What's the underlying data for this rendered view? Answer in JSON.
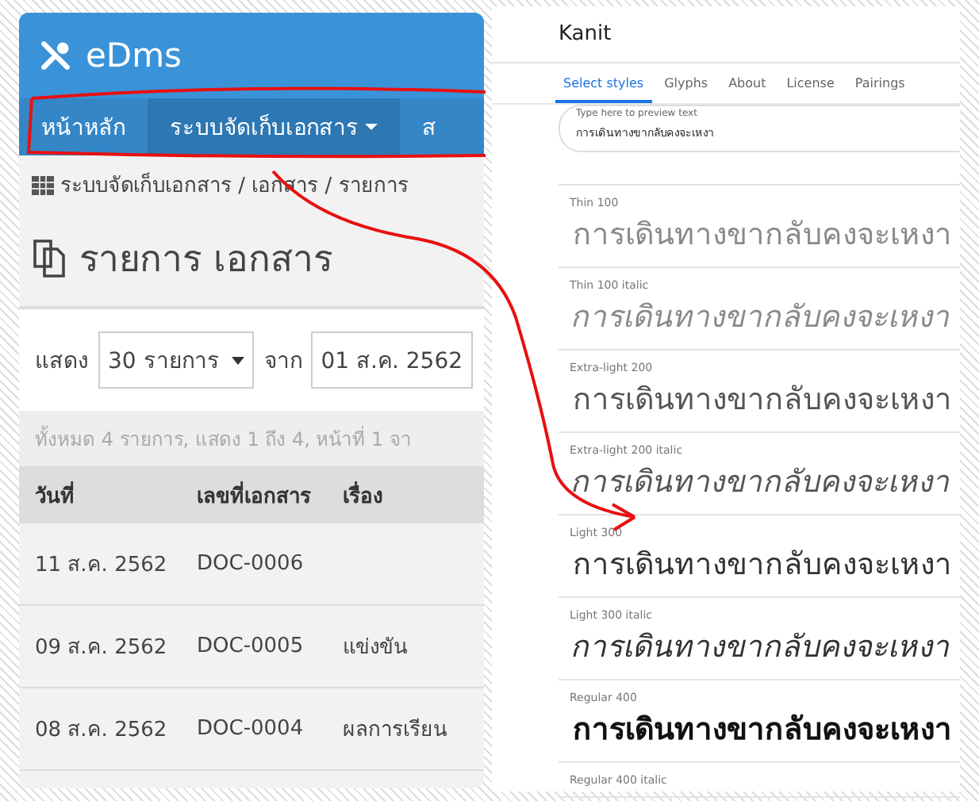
{
  "left_window": {
    "app_title": "eDms",
    "nav": [
      {
        "label": "หน้าหลัก",
        "selected": false,
        "dropdown": false
      },
      {
        "label": "ระบบจัดเก็บเอกสาร",
        "selected": true,
        "dropdown": true
      },
      {
        "label": "ส",
        "selected": false,
        "dropdown": false
      }
    ],
    "breadcrumb": "ระบบจัดเก็บเอกสาร / เอกสาร / รายการ",
    "page_title": "รายการ เอกสาร",
    "filter": {
      "show_label": "แสดง",
      "page_size": "30 รายการ",
      "from_label": "จาก",
      "from_date": "01 ส.ค. 2562"
    },
    "summary": "ทั้งหมด 4 รายการ, แสดง 1 ถึง 4, หน้าที่ 1 จา",
    "table": {
      "columns": [
        "วันที่",
        "เลขที่เอกสาร",
        "เรื่อง"
      ],
      "rows": [
        {
          "date": "11 ส.ค. 2562",
          "doc_no": "DOC-0006"
        },
        {
          "date": "09 ส.ค. 2562",
          "doc_no": "DOC-0005",
          "subject": "แข่งขัน"
        },
        {
          "date": "08 ส.ค. 2562",
          "doc_no": "DOC-0004",
          "subject": "ผลการเรียน"
        }
      ]
    }
  },
  "right_window": {
    "font_name": "Kanit",
    "tabs": [
      {
        "label": "Select styles",
        "selected": true
      },
      {
        "label": "Glyphs",
        "selected": false
      },
      {
        "label": "About",
        "selected": false
      },
      {
        "label": "License",
        "selected": false
      },
      {
        "label": "Pairings",
        "selected": false
      }
    ],
    "preview_field": {
      "label": "Type here to preview text",
      "value": "การเดินทางขากลับคงจะเหงา"
    },
    "styles": [
      {
        "label": "Thin 100",
        "kind": "thin",
        "italic": false,
        "sample": "การเดินทางขากลับคงจะเหงา"
      },
      {
        "label": "Thin 100 italic",
        "kind": "thin",
        "italic": true,
        "sample": "การเดินทางขากลับคงจะเหงา"
      },
      {
        "label": "Extra-light 200",
        "kind": "extralight",
        "italic": false,
        "sample": "การเดินทางขากลับคงจะเหงา"
      },
      {
        "label": "Extra-light 200 italic",
        "kind": "extralight",
        "italic": true,
        "sample": "การเดินทางขากลับคงจะเหงา"
      },
      {
        "label": "Light 300",
        "kind": "light",
        "italic": false,
        "sample": "การเดินทางขากลับคงจะเหงา"
      },
      {
        "label": "Light 300 italic",
        "kind": "light",
        "italic": true,
        "sample": "การเดินทางขากลับคงจะเหงา"
      },
      {
        "label": "Regular 400",
        "kind": "regular",
        "italic": false,
        "sample": "การเดินทางขากลับคงจะเหงา"
      },
      {
        "label": "Regular 400 italic"
      }
    ]
  }
}
